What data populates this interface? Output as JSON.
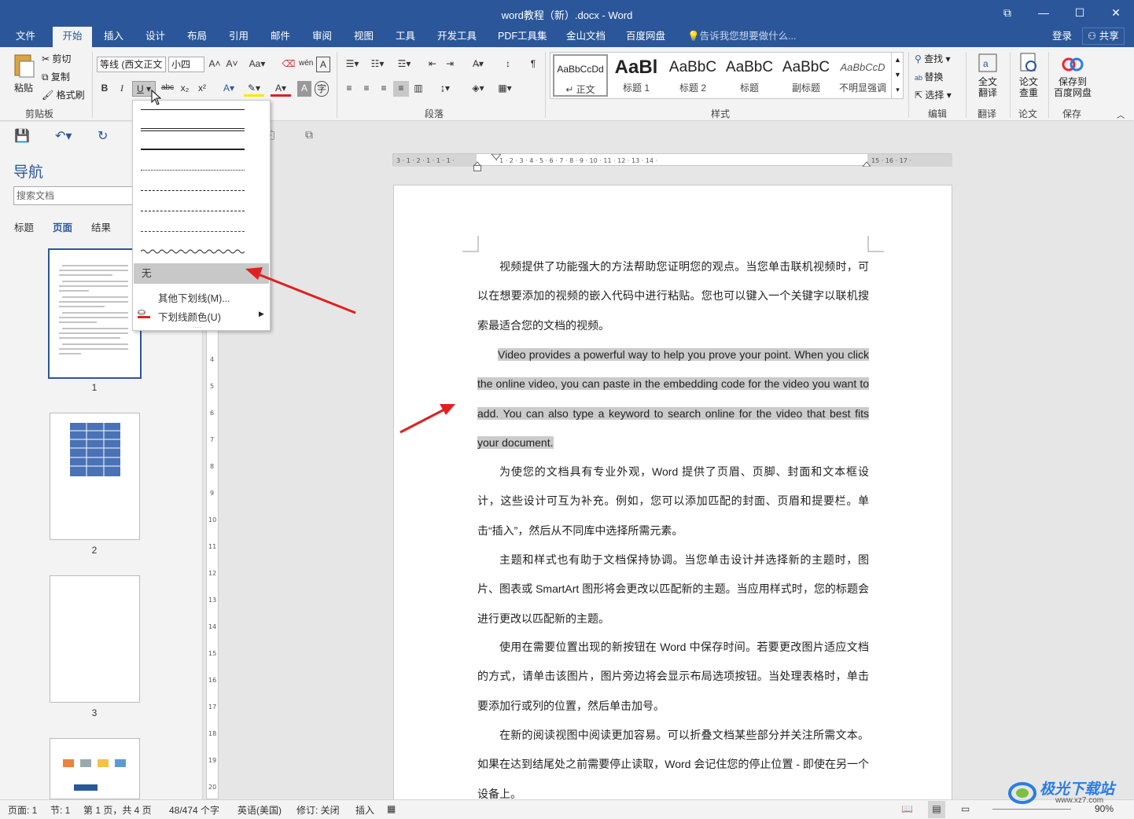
{
  "window": {
    "title": "word教程（新）.docx - Word"
  },
  "tabs": [
    "文件",
    "开始",
    "插入",
    "设计",
    "布局",
    "引用",
    "邮件",
    "审阅",
    "视图",
    "工具",
    "开发工具",
    "PDF工具集",
    "金山文档",
    "百度网盘"
  ],
  "tell_me": "告诉我您想要做什么...",
  "account": {
    "login": "登录",
    "share": "共享"
  },
  "clipboard": {
    "paste": "粘贴",
    "cut": "剪切",
    "copy": "复制",
    "format_painter": "格式刷",
    "label": "剪贴板"
  },
  "font": {
    "name": "等线 (西文正文",
    "size": "小四"
  },
  "paragraph_label": "段落",
  "styles": {
    "label": "样式",
    "items": [
      {
        "preview": "AaBbCcDd",
        "name": "↵ 正文"
      },
      {
        "preview": "AaBl",
        "name": "标题 1"
      },
      {
        "preview": "AaBbC",
        "name": "标题 2"
      },
      {
        "preview": "AaBbC",
        "name": "标题"
      },
      {
        "preview": "AaBbC",
        "name": "副标题"
      },
      {
        "preview": "AaBbCcD",
        "name": "不明显强调"
      }
    ]
  },
  "editing": {
    "find": "查找",
    "replace": "替换",
    "select": "选择",
    "label": "编辑"
  },
  "translate": {
    "btn1": "全文",
    "btn2": "翻译",
    "label": "翻译"
  },
  "paper": {
    "btn1": "论文",
    "btn2": "查重",
    "label": "论文"
  },
  "save": {
    "btn1": "保存到",
    "btn2": "百度网盘",
    "label": "保存"
  },
  "nav": {
    "title": "导航",
    "search_placeholder": "搜索文档",
    "tabs": [
      "标题",
      "页面",
      "结果"
    ],
    "pages": [
      "1",
      "2",
      "3"
    ]
  },
  "underline_menu": {
    "none": "无",
    "more": "其他下划线(M)...",
    "color": "下划线颜色(U)"
  },
  "document": {
    "paragraphs": [
      "视频提供了功能强大的方法帮助您证明您的观点。当您单击联机视频时，可以在想要添加的视频的嵌入代码中进行粘贴。您也可以键入一个关键字以联机搜索最适合您的文档的视频。",
      "Video provides a powerful way to help you prove your point. When you click the online video, you can paste in the embedding code for the video you want to add. You can also type a keyword to search online for the video that best fits your document.",
      "为使您的文档具有专业外观，Word 提供了页眉、页脚、封面和文本框设计，这些设计可互为补充。例如，您可以添加匹配的封面、页眉和提要栏。单击“插入”，然后从不同库中选择所需元素。",
      "主题和样式也有助于文档保持协调。当您单击设计并选择新的主题时，图片、图表或 SmartArt 图形将会更改以匹配新的主题。当应用样式时，您的标题会进行更改以匹配新的主题。",
      "使用在需要位置出现的新按钮在 Word 中保存时间。若要更改图片适应文档的方式，请单击该图片，图片旁边将会显示布局选项按钮。当处理表格时，单击要添加行或列的位置，然后单击加号。",
      "在新的阅读视图中阅读更加容易。可以折叠文档某些部分并关注所需文本。如果在达到结尾处之前需要停止读取，Word 会记住您的停止位置 - 即使在另一个设备上。"
    ]
  },
  "status": {
    "page": "页面: 1",
    "section": "节: 1",
    "pages": "第 1 页，共 4 页",
    "words": "48/474 个字",
    "lang": "英语(美国)",
    "track": "修订: 关闭",
    "insert": "插入",
    "zoom": "90%"
  },
  "watermark": {
    "text": "极光下载站",
    "url": "www.xz7.com"
  },
  "colors": {
    "accent": "#2b579a",
    "arrow": "#e02020",
    "highlight": "#cbcbcb"
  }
}
